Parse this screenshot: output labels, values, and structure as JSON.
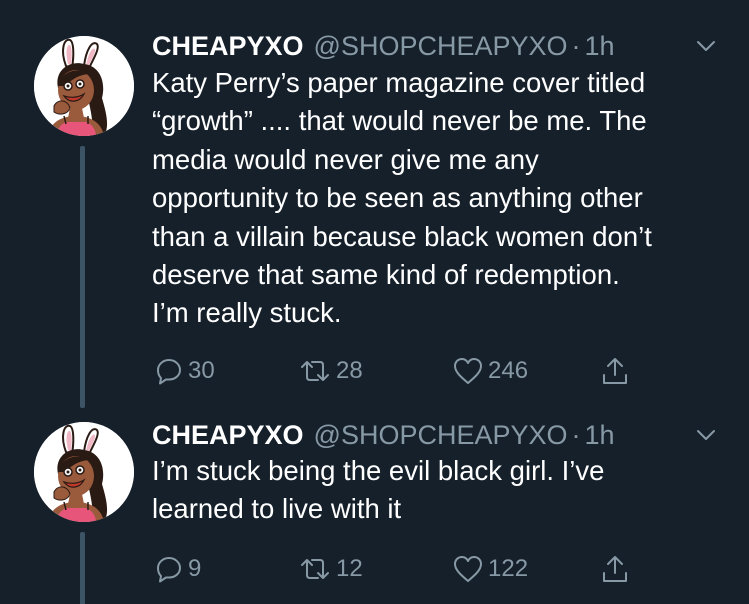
{
  "colors": {
    "background": "#15202b",
    "text": "#ffffff",
    "muted": "#8899a6",
    "thread_line": "#3d5466",
    "avatar_bg": "#ffffff",
    "avatar_skin": "#9a5a3c",
    "avatar_hair": "#2a1a14",
    "avatar_top": "#e8557a"
  },
  "tweets": [
    {
      "author_name": "CHEAPYXO",
      "author_handle": "@SHOPCHEAPYXO",
      "dot": "·",
      "time": "1h",
      "avatar_icon": "bunny-ears-avatar",
      "text_lines": [
        "Katy Perry’s paper magazine cover titled",
        "“growth” .... that would never be me. The",
        "media would never give me any",
        "opportunity to be seen as anything other",
        "than a villain because black women don’t",
        "deserve that same kind of redemption.",
        "I’m really stuck."
      ],
      "replies": "30",
      "retweets": "28",
      "likes": "246"
    },
    {
      "author_name": "CHEAPYXO",
      "author_handle": "@SHOPCHEAPYXO",
      "dot": "·",
      "time": "1h",
      "avatar_icon": "bunny-ears-avatar",
      "text_lines": [
        "I’m stuck being the evil black girl. I’ve",
        "learned to live with it"
      ],
      "replies": "9",
      "retweets": "12",
      "likes": "122"
    }
  ],
  "icons": {
    "reply": "reply-icon",
    "retweet": "retweet-icon",
    "like": "heart-icon",
    "share": "share-icon",
    "menu": "chevron-down-icon"
  }
}
